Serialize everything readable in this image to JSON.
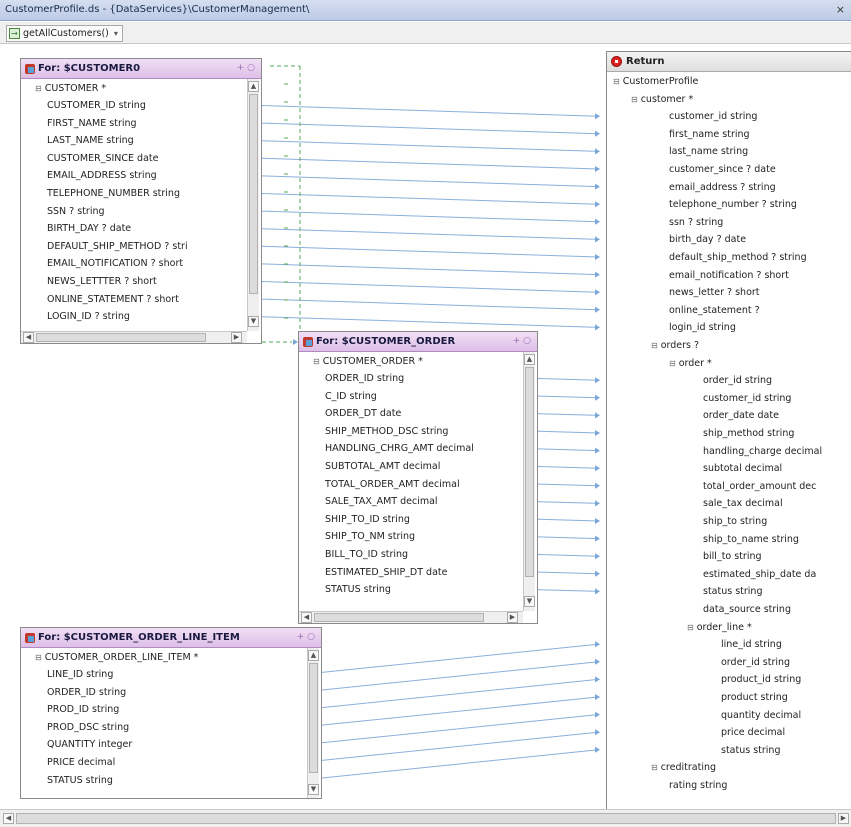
{
  "window": {
    "title": "CustomerProfile.ds - {DataServices}\\CustomerManagement\\",
    "close_glyph": "×"
  },
  "toolbar": {
    "function_label": "getAllCustomers()",
    "dropdown_glyph": "▾"
  },
  "customer_box": {
    "title": "For: $CUSTOMER0",
    "element": "CUSTOMER *",
    "fields": [
      "CUSTOMER_ID string",
      "FIRST_NAME string",
      "LAST_NAME string",
      "CUSTOMER_SINCE date",
      "EMAIL_ADDRESS string",
      "TELEPHONE_NUMBER string",
      "SSN ? string",
      "BIRTH_DAY ? date",
      "DEFAULT_SHIP_METHOD ? stri",
      "EMAIL_NOTIFICATION ? short",
      "NEWS_LETTTER ? short",
      "ONLINE_STATEMENT ? short",
      "LOGIN_ID ? string"
    ]
  },
  "order_box": {
    "title": "For: $CUSTOMER_ORDER",
    "element": "CUSTOMER_ORDER *",
    "fields": [
      "ORDER_ID string",
      "C_ID string",
      "ORDER_DT date",
      "SHIP_METHOD_DSC string",
      "HANDLING_CHRG_AMT decimal",
      "SUBTOTAL_AMT decimal",
      "TOTAL_ORDER_AMT decimal",
      "SALE_TAX_AMT decimal",
      "SHIP_TO_ID string",
      "SHIP_TO_NM string",
      "BILL_TO_ID string",
      "ESTIMATED_SHIP_DT date",
      "STATUS string"
    ]
  },
  "line_box": {
    "title": "For: $CUSTOMER_ORDER_LINE_ITEM",
    "element": "CUSTOMER_ORDER_LINE_ITEM *",
    "fields": [
      "LINE_ID string",
      "ORDER_ID string",
      "PROD_ID string",
      "PROD_DSC string",
      "QUANTITY integer",
      "PRICE decimal",
      "STATUS string"
    ]
  },
  "return_box": {
    "title": "Return",
    "rows": [
      "CustomerProfile",
      "customer *",
      "customer_id string",
      "first_name string",
      "last_name string",
      "customer_since ? date",
      "email_address ? string",
      "telephone_number ? string",
      "ssn ? string",
      "birth_day ? date",
      "default_ship_method ? string",
      "email_notification ? short",
      "news_letter ? short",
      "online_statement ?",
      "login_id string",
      "orders ?",
      "order *",
      "order_id string",
      "customer_id string",
      "order_date date",
      "ship_method string",
      "handling_charge decimal",
      "subtotal decimal",
      "total_order_amount dec",
      "sale_tax decimal",
      "ship_to string",
      "ship_to_name string",
      "bill_to string",
      "estimated_ship_date da",
      "status string",
      "data_source string",
      "order_line *",
      "line_id string",
      "order_id string",
      "product_id string",
      "product string",
      "quantity decimal",
      "price decimal",
      "status string",
      "creditrating",
      "rating string"
    ]
  }
}
